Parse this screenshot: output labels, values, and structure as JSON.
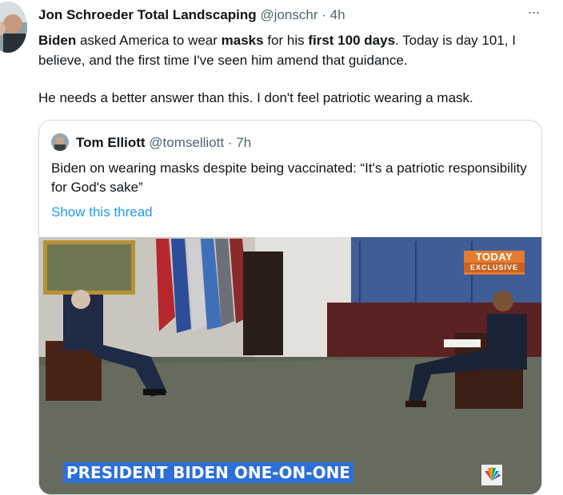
{
  "tweet": {
    "author_name": "Jon Schroeder Total Landscaping",
    "handle": "@jonschr",
    "separator": "·",
    "time": "4h",
    "more_label": "···",
    "text_parts": {
      "p1_a": "Biden",
      "p1_b": " asked America to wear ",
      "p1_c": "masks",
      "p1_d": " for his ",
      "p1_e": "first 100 days",
      "p1_f": ". Today is day 101, I believe, and the first time I've seen him amend that guidance.",
      "p2": "He needs a better answer than this. I don't feel patriotic wearing a mask."
    }
  },
  "quoted": {
    "author_name": "Tom Elliott",
    "handle": "@tomselliott",
    "separator": "·",
    "time": "7h",
    "text": "Biden on wearing masks despite being vaccinated: “It's a patriotic responsibility for God's sake”",
    "show_thread": "Show this thread",
    "media": {
      "banner": "PRESIDENT BIDEN ONE-ON-ONE",
      "network_badge_line1": "TODAY",
      "network_badge_line2": "EXCLUSIVE"
    }
  },
  "colors": {
    "link": "#1d9bf0",
    "secondary_text": "#536471",
    "banner_blue": "#2c6fd6",
    "today_orange": "#e37c2f"
  }
}
